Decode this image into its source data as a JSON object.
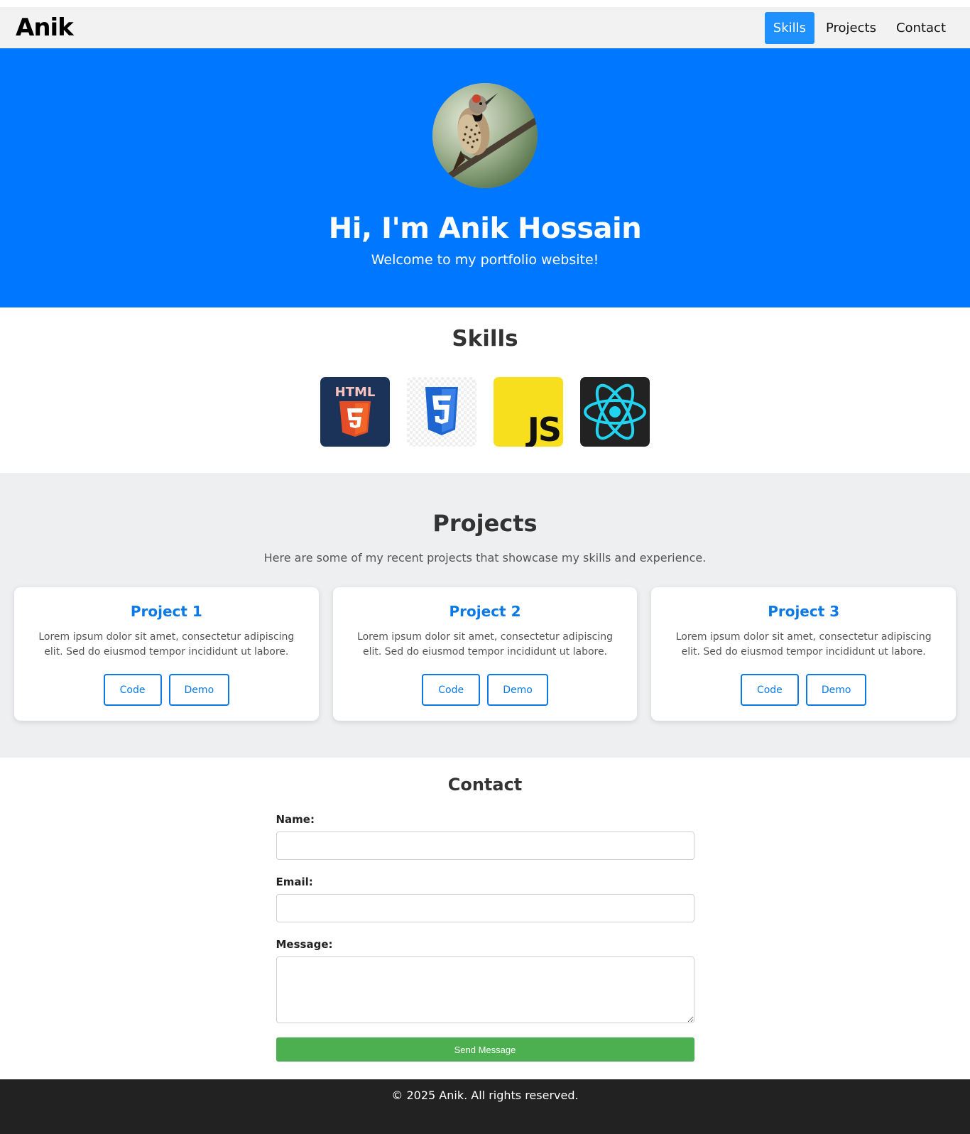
{
  "header": {
    "logo": "Anik",
    "nav": [
      {
        "label": "Skills",
        "active": true
      },
      {
        "label": "Projects",
        "active": false
      },
      {
        "label": "Contact",
        "active": false
      }
    ]
  },
  "hero": {
    "title": "Hi, I'm Anik Hossain",
    "subtitle": "Welcome to my portfolio website!"
  },
  "skills": {
    "title": "Skills",
    "icons": [
      "html5-icon",
      "css3-icon",
      "javascript-icon",
      "react-icon"
    ]
  },
  "projects": {
    "title": "Projects",
    "intro": "Here are some of my recent projects that showcase my skills and experience.",
    "items": [
      {
        "title": "Project 1",
        "description": "Lorem ipsum dolor sit amet, consectetur adipiscing elit. Sed do eiusmod tempor incididunt ut labore.",
        "code_label": "Code",
        "demo_label": "Demo"
      },
      {
        "title": "Project 2",
        "description": "Lorem ipsum dolor sit amet, consectetur adipiscing elit. Sed do eiusmod tempor incididunt ut labore.",
        "code_label": "Code",
        "demo_label": "Demo"
      },
      {
        "title": "Project 3",
        "description": "Lorem ipsum dolor sit amet, consectetur adipiscing elit. Sed do eiusmod tempor incididunt ut labore.",
        "code_label": "Code",
        "demo_label": "Demo"
      }
    ]
  },
  "contact": {
    "title": "Contact",
    "name_label": "Name:",
    "name_value": "",
    "email_label": "Email:",
    "email_value": "",
    "message_label": "Message:",
    "message_value": "",
    "submit_label": "Send Message"
  },
  "footer": {
    "text": "© 2025 Anik. All rights reserved."
  },
  "colors": {
    "primary": "#0077ff",
    "nav_active": "#1e90ff",
    "project_title": "#0b7ae6",
    "submit": "#4caf50",
    "footer_bg": "#222222",
    "projects_bg": "#eeeff1"
  }
}
